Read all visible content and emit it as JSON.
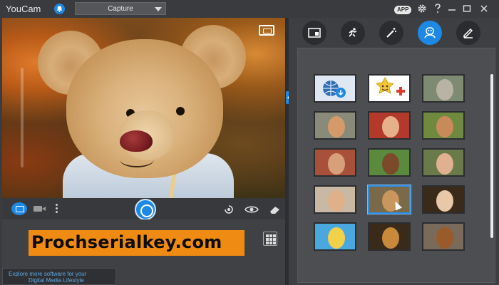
{
  "titlebar": {
    "app_title": "YouCam",
    "mode_selected": "Capture",
    "app_badge": "APP",
    "icons": [
      "bell-icon",
      "gear-icon",
      "help-icon",
      "minimize-icon",
      "maximize-icon",
      "close-icon"
    ]
  },
  "watermark_text": "Prochserialkey.com",
  "promo": {
    "line1": "Explore more software for your",
    "line2": "Digital Media Lifestyle"
  },
  "controls": {
    "icons": [
      "photo-camera-icon",
      "video-camera-icon",
      "more-options-icon",
      "shutter-icon",
      "face-login-icon",
      "eye-icon",
      "eraser-icon",
      "grid-icon"
    ]
  },
  "tabs": [
    {
      "name": "frames",
      "icon": "frame-icon",
      "active": false
    },
    {
      "name": "particles",
      "icon": "running-man-icon",
      "active": false
    },
    {
      "name": "effects",
      "icon": "magic-wand-icon",
      "active": false
    },
    {
      "name": "avatars",
      "icon": "avatar-icon",
      "active": true
    },
    {
      "name": "brushes",
      "icon": "pencil-icon",
      "active": false
    }
  ],
  "avatars": [
    {
      "name": "download-more",
      "color": "#2f6fb7",
      "bg": "#dfe7f2",
      "selected": false
    },
    {
      "name": "add-custom",
      "color": "#f3c531",
      "bg": "#ffffff",
      "selected": false
    },
    {
      "name": "statue",
      "color": "#b9b3a5",
      "bg": "#7f8a73",
      "selected": false
    },
    {
      "name": "woman-castle",
      "color": "#d49a6a",
      "bg": "#8a8a7a",
      "selected": false
    },
    {
      "name": "red-hair-barn",
      "color": "#e6b08a",
      "bg": "#b33a2a",
      "selected": false
    },
    {
      "name": "man-field",
      "color": "#c98a5a",
      "bg": "#6f8a3e",
      "selected": false
    },
    {
      "name": "woman-palace",
      "color": "#d8a07a",
      "bg": "#a8503a",
      "selected": false
    },
    {
      "name": "dark-man-field",
      "color": "#7a4a2a",
      "bg": "#5a8a3e",
      "selected": false
    },
    {
      "name": "curly-woman",
      "color": "#e0b090",
      "bg": "#6a7a4a",
      "selected": false
    },
    {
      "name": "man-office",
      "color": "#e0b08a",
      "bg": "#c9b8a4",
      "selected": false
    },
    {
      "name": "teddy-bear",
      "color": "#c8965e",
      "bg": "#7a6a4a",
      "selected": true
    },
    {
      "name": "old-man",
      "color": "#e8c8a8",
      "bg": "#3a2a1a",
      "selected": false
    },
    {
      "name": "clown",
      "color": "#f2d04a",
      "bg": "#49a8e0",
      "selected": false
    },
    {
      "name": "dog",
      "color": "#c88a3a",
      "bg": "#3a2a1a",
      "selected": false
    },
    {
      "name": "poodle",
      "color": "#9a5a2a",
      "bg": "#7a6a5a",
      "selected": false
    }
  ]
}
